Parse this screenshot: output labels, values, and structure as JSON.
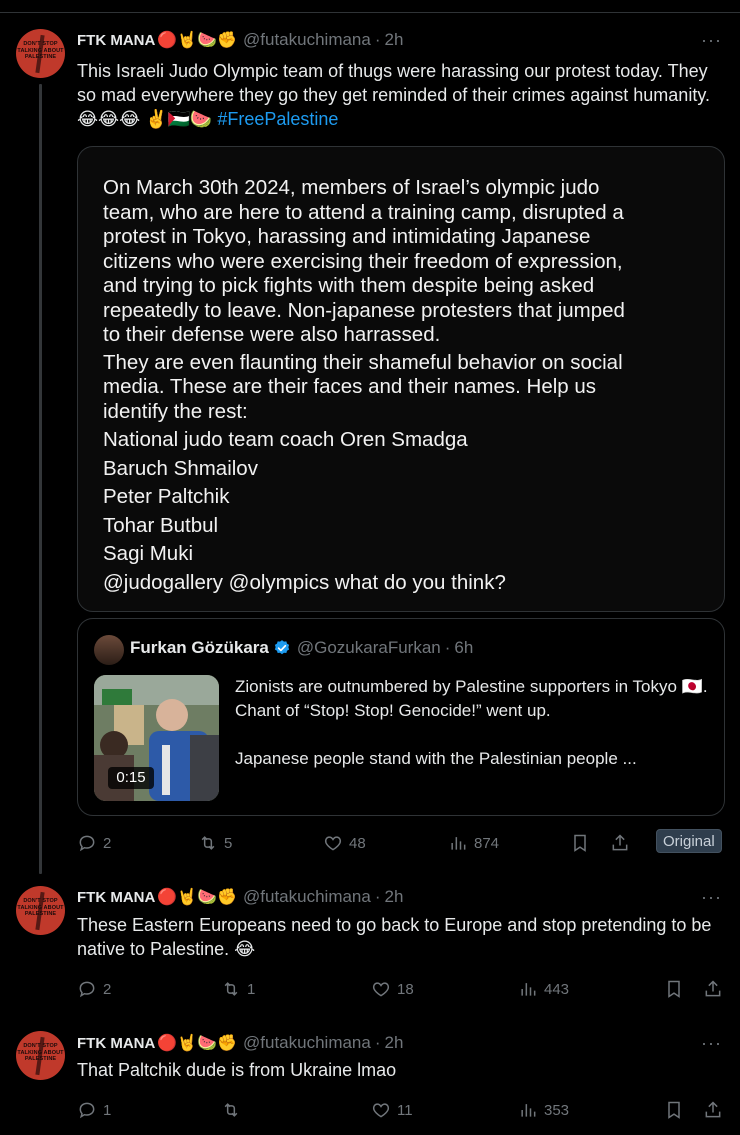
{
  "posts": [
    {
      "name": "FTK MANA",
      "emojis": "🔴🤘🍉✊",
      "handle": "@futakuchimana",
      "time": "2h",
      "avatar_text": "DON'T STOP TALKING ABOUT PALESTINE",
      "text": "This Israeli Judo Olympic team of thugs were harassing our protest today. They so mad everywhere they go they get reminded of their crimes against humanity. 😂😂😂 ✌️🇵🇸🍉",
      "hashtag": "#FreePalestine",
      "image_text_lines": [
        "On March 30th 2024, members of Israel’s olympic judo",
        "team, who are here to attend a training camp, disrupted a",
        "protest in Tokyo, harassing and intimidating Japanese",
        "citizens who were exercising their freedom of expression,",
        "and trying to pick fights with them despite being asked",
        "repeatedly to leave. Non-japanese protesters that jumped",
        "to their defense were also harrassed.",
        "They are even flaunting their shameful behavior on social",
        "media. These are their faces and their names. Help us",
        "identify the rest:",
        "National judo team coach Oren Smadga",
        "Baruch Shmailov",
        "Peter Paltchik",
        "Tohar Butbul",
        "Sagi Muki",
        "@judogallery  @olympics what do you think?"
      ],
      "quote": {
        "name": "Furkan Gözükara",
        "handle": "@GozukaraFurkan",
        "time": "6h",
        "video_duration": "0:15",
        "line1": "Zionists are outnumbered by Palestine supporters in Tokyo 🇯🇵.",
        "line2": "Chant of “Stop! Stop! Genocide!” went up.",
        "line3": "Japanese people stand with the Palestinian people ..."
      },
      "stats": {
        "replies": "2",
        "reposts": "5",
        "likes": "48",
        "views": "874"
      },
      "original_label": "Original"
    },
    {
      "name": "FTK MANA",
      "emojis": "🔴🤘🍉✊",
      "handle": "@futakuchimana",
      "time": "2h",
      "avatar_text": "DON'T STOP TALKING ABOUT PALESTINE",
      "text": "These Eastern Europeans need to go back to Europe and stop pretending to be native to Palestine. 😂",
      "stats": {
        "replies": "2",
        "reposts": "1",
        "likes": "18",
        "views": "443"
      }
    },
    {
      "name": "FTK MANA",
      "emojis": "🔴🤘🍉✊",
      "handle": "@futakuchimana",
      "time": "2h",
      "avatar_text": "DON'T STOP TALKING ABOUT PALESTINE",
      "text": "That Paltchik dude is from Ukraine lmao",
      "stats": {
        "replies": "1",
        "reposts": "",
        "likes": "11",
        "views": "353"
      }
    }
  ],
  "separator": "·",
  "more_glyph": "···",
  "colors": {
    "background": "#000000",
    "text": "#e7e9ea",
    "muted": "#71767b",
    "link": "#1d9bf0",
    "border": "#2f3336",
    "verified": "#1d9bf0"
  }
}
